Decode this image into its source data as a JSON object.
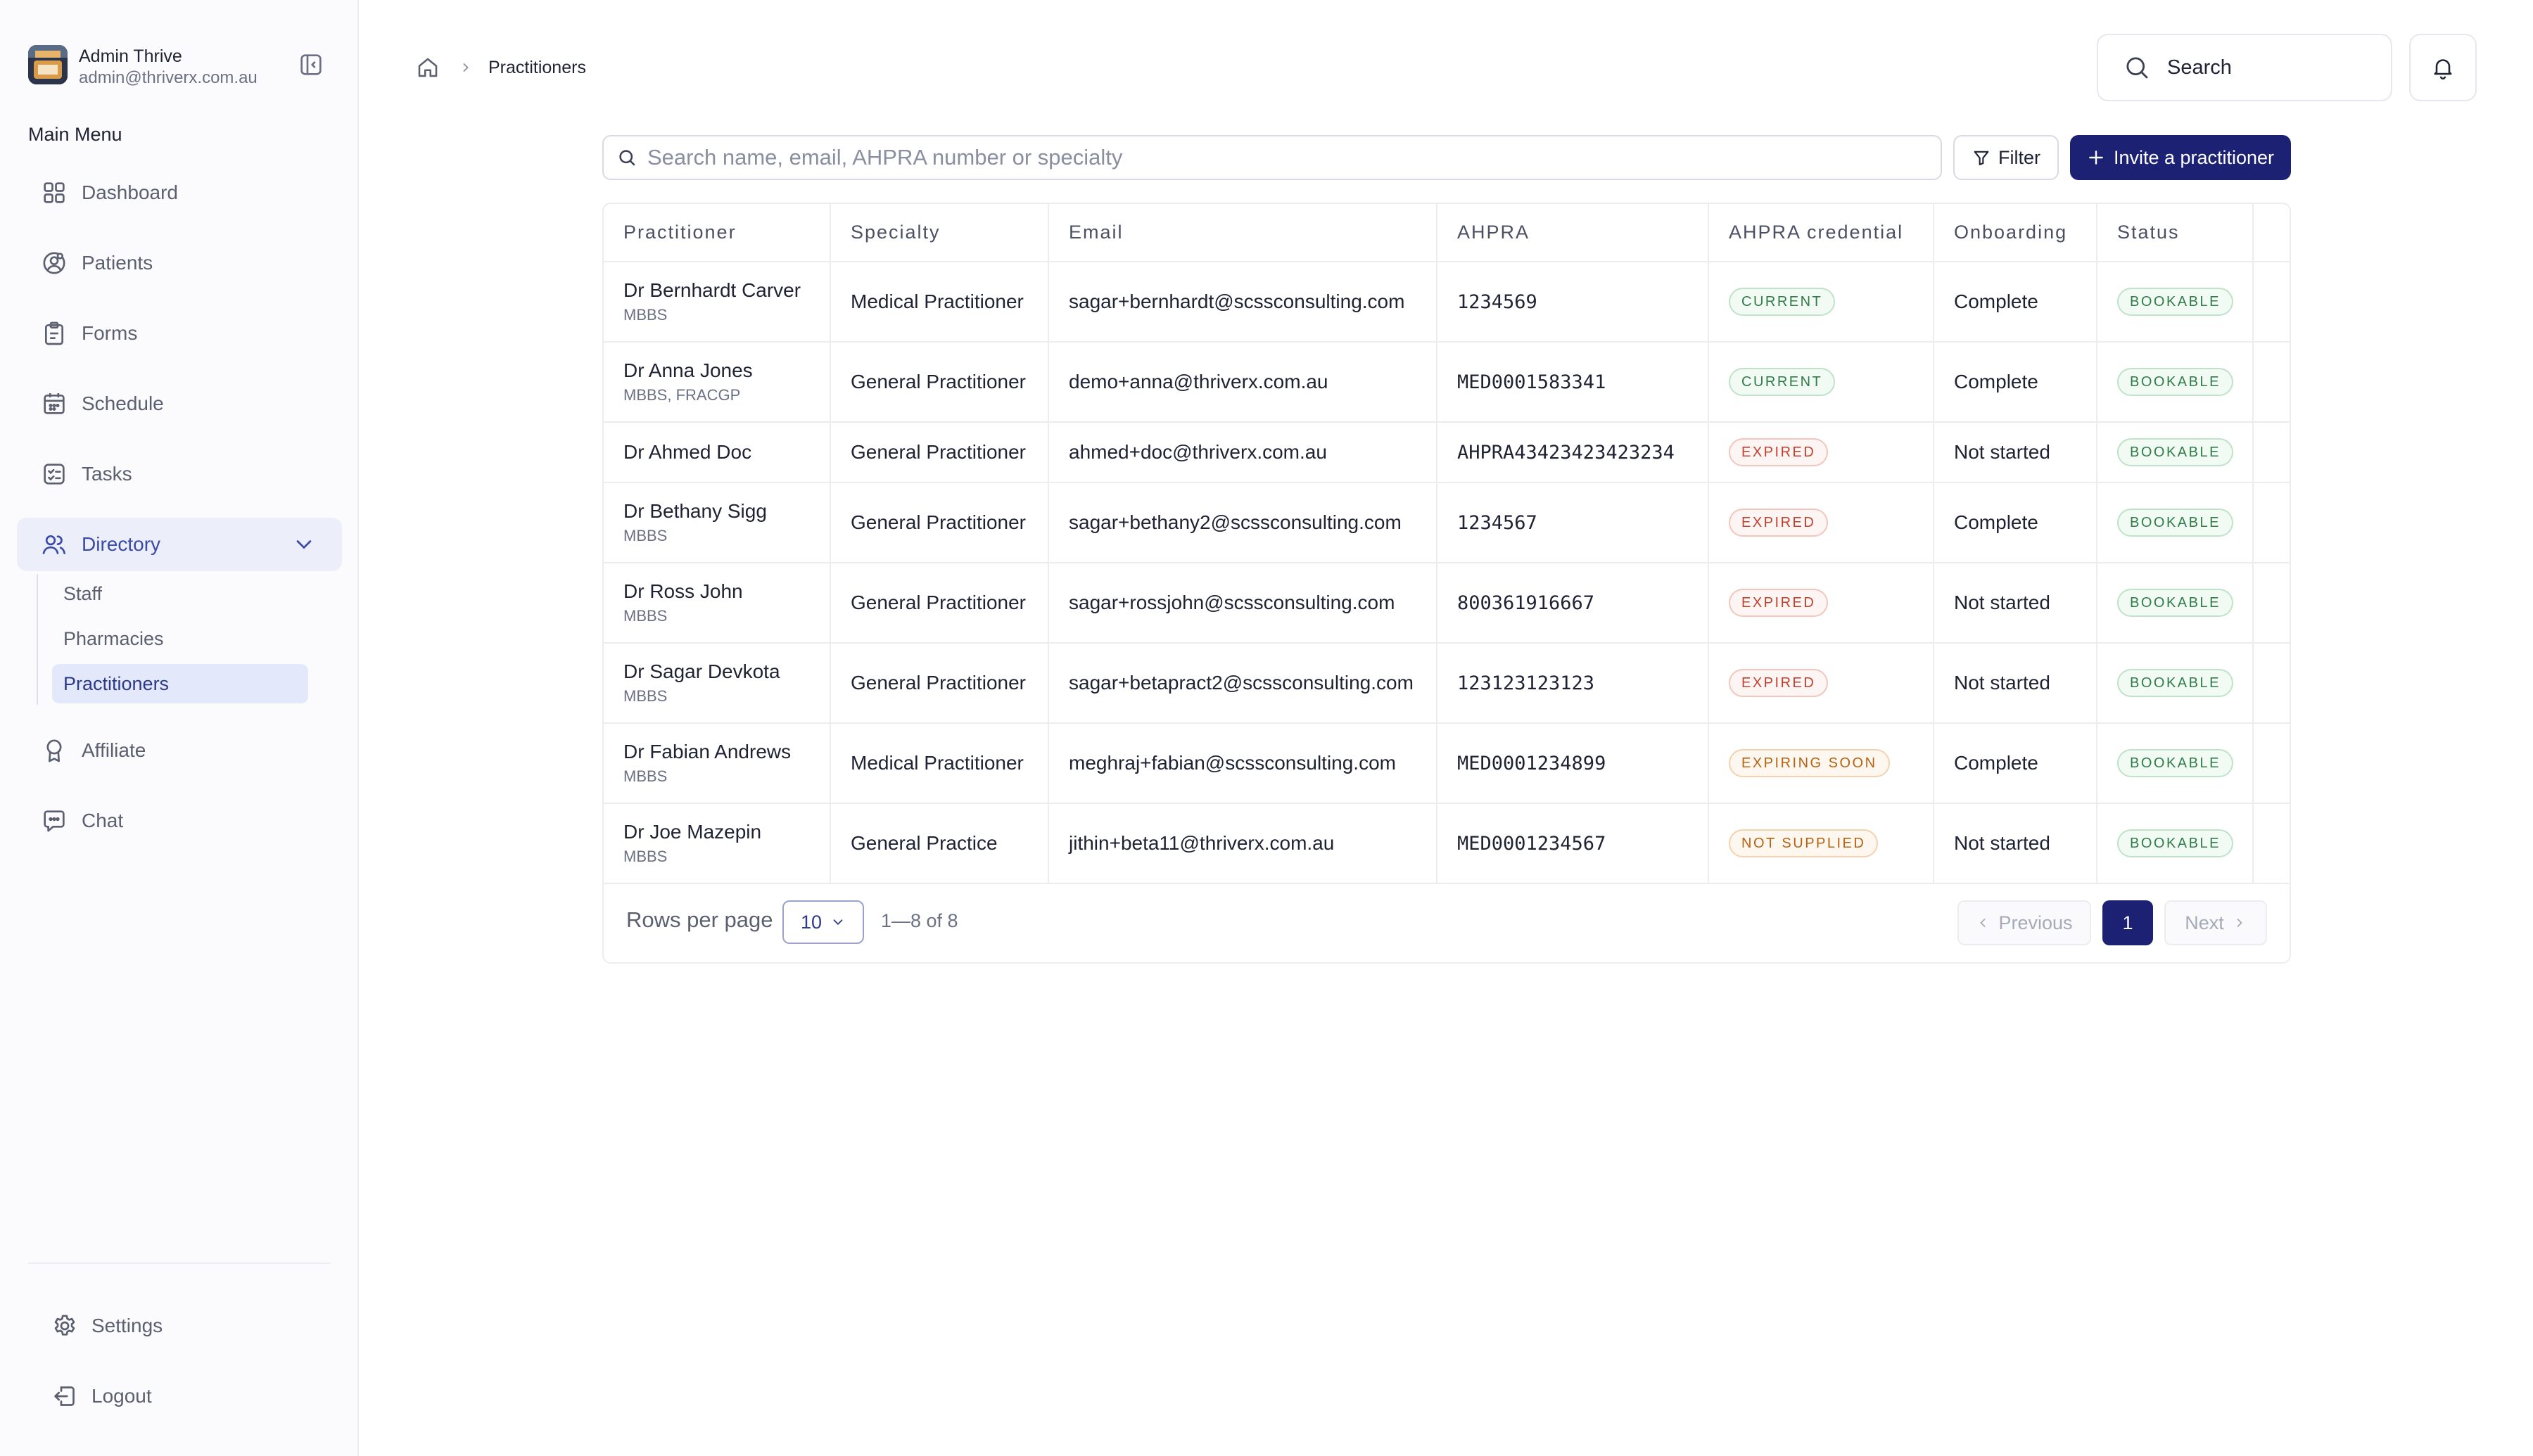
{
  "profile": {
    "name": "Admin Thrive",
    "email": "admin@thriverx.com.au"
  },
  "sidebar": {
    "menu_title": "Main Menu",
    "items": [
      {
        "label": "Dashboard",
        "icon": "grid-icon"
      },
      {
        "label": "Patients",
        "icon": "patients-icon"
      },
      {
        "label": "Forms",
        "icon": "clipboard-icon"
      },
      {
        "label": "Schedule",
        "icon": "calendar-icon"
      },
      {
        "label": "Tasks",
        "icon": "tasks-icon"
      },
      {
        "label": "Directory",
        "icon": "users-icon",
        "active": true,
        "expanded": true
      },
      {
        "label": "Affiliate",
        "icon": "award-icon"
      },
      {
        "label": "Chat",
        "icon": "chat-icon"
      }
    ],
    "directory_sub": [
      {
        "label": "Staff"
      },
      {
        "label": "Pharmacies"
      },
      {
        "label": "Practitioners",
        "active": true
      }
    ],
    "bottom": [
      {
        "label": "Settings",
        "icon": "gear-icon"
      },
      {
        "label": "Logout",
        "icon": "logout-icon"
      }
    ]
  },
  "breadcrumb": {
    "current": "Practitioners"
  },
  "topbar": {
    "search_label": "Search"
  },
  "toolbar": {
    "search_placeholder": "Search name, email, AHPRA number or specialty",
    "filter_label": "Filter",
    "invite_label": "Invite a practitioner"
  },
  "table": {
    "columns": [
      "Practitioner",
      "Specialty",
      "Email",
      "AHPRA",
      "AHPRA credential",
      "Onboarding",
      "Status"
    ],
    "rows": [
      {
        "name": "Dr Bernhardt Carver",
        "qual": "MBBS",
        "specialty": "Medical Practitioner",
        "email": "sagar+bernhardt@scssconsulting.com",
        "ahpra": "1234569",
        "credential": "CURRENT",
        "onboarding": "Complete",
        "status": "BOOKABLE"
      },
      {
        "name": "Dr Anna Jones",
        "qual": "MBBS, FRACGP",
        "specialty": "General Practitioner",
        "email": "demo+anna@thriverx.com.au",
        "ahpra": "MED0001583341",
        "credential": "CURRENT",
        "onboarding": "Complete",
        "status": "BOOKABLE"
      },
      {
        "name": "Dr Ahmed Doc",
        "qual": "",
        "specialty": "General Practitioner",
        "email": "ahmed+doc@thriverx.com.au",
        "ahpra": "AHPRA43423423423234",
        "credential": "EXPIRED",
        "onboarding": "Not started",
        "status": "BOOKABLE"
      },
      {
        "name": "Dr Bethany Sigg",
        "qual": "MBBS",
        "specialty": "General Practitioner",
        "email": "sagar+bethany2@scssconsulting.com",
        "ahpra": "1234567",
        "credential": "EXPIRED",
        "onboarding": "Complete",
        "status": "BOOKABLE"
      },
      {
        "name": "Dr Ross John",
        "qual": "MBBS",
        "specialty": "General Practitioner",
        "email": "sagar+rossjohn@scssconsulting.com",
        "ahpra": "800361916667",
        "credential": "EXPIRED",
        "onboarding": "Not started",
        "status": "BOOKABLE"
      },
      {
        "name": "Dr Sagar Devkota",
        "qual": "MBBS",
        "specialty": "General Practitioner",
        "email": "sagar+betapract2@scssconsulting.com",
        "ahpra": "123123123123",
        "credential": "EXPIRED",
        "onboarding": "Not started",
        "status": "BOOKABLE"
      },
      {
        "name": "Dr Fabian Andrews",
        "qual": "MBBS",
        "specialty": "Medical Practitioner",
        "email": "meghraj+fabian@scssconsulting.com",
        "ahpra": "MED0001234899",
        "credential": "EXPIRING SOON",
        "onboarding": "Complete",
        "status": "BOOKABLE"
      },
      {
        "name": "Dr Joe Mazepin",
        "qual": "MBBS",
        "specialty": "General Practice",
        "email": "jithin+beta11@thriverx.com.au",
        "ahpra": "MED0001234567",
        "credential": "NOT SUPPLIED",
        "onboarding": "Not started",
        "status": "BOOKABLE"
      }
    ]
  },
  "pagination": {
    "rows_per_page_label": "Rows per page",
    "rows_per_page": "10",
    "range": "1—8 of 8",
    "previous_label": "Previous",
    "current_page": "1",
    "next_label": "Next"
  },
  "colors": {
    "primary": "#1c2174",
    "active_nav_bg": "#eceefa",
    "badge_green": "#2f7d49",
    "badge_red": "#c2412d",
    "badge_orange": "#b8620f"
  }
}
